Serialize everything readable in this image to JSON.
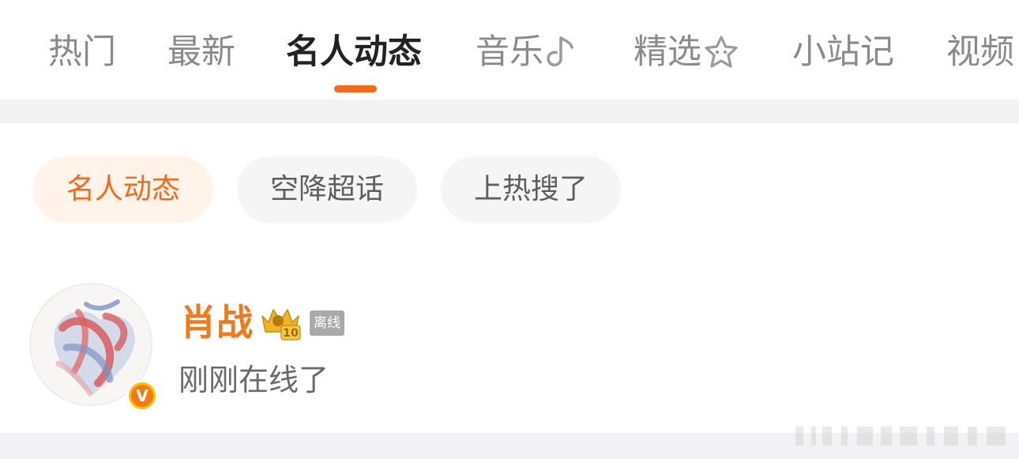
{
  "tabs": [
    {
      "label": "热门"
    },
    {
      "label": "最新"
    },
    {
      "label": "名人动态",
      "active": true,
      "indicator_color": "#f26a1b"
    },
    {
      "label": "音乐",
      "icon": "music-note-icon"
    },
    {
      "label": "精选",
      "icon": "star-face-icon"
    },
    {
      "label": "小站记"
    },
    {
      "label": "视频"
    }
  ],
  "filter_chips": [
    {
      "label": "名人动态",
      "active": true
    },
    {
      "label": "空降超话"
    },
    {
      "label": "上热搜了"
    }
  ],
  "feed_item": {
    "username": "肖战",
    "level_badge": "10",
    "verified_badge": "V",
    "presence_badge": "离线",
    "status_text": "刚刚在线了",
    "avatar_icon": "painted-heart-avatar",
    "name_color": "#f27a16"
  },
  "colors": {
    "accent": "#f26a1b",
    "chip_active_bg": "#fff3ea",
    "chip_bg": "#f5f5f5",
    "separator": "#f2f2f4"
  }
}
